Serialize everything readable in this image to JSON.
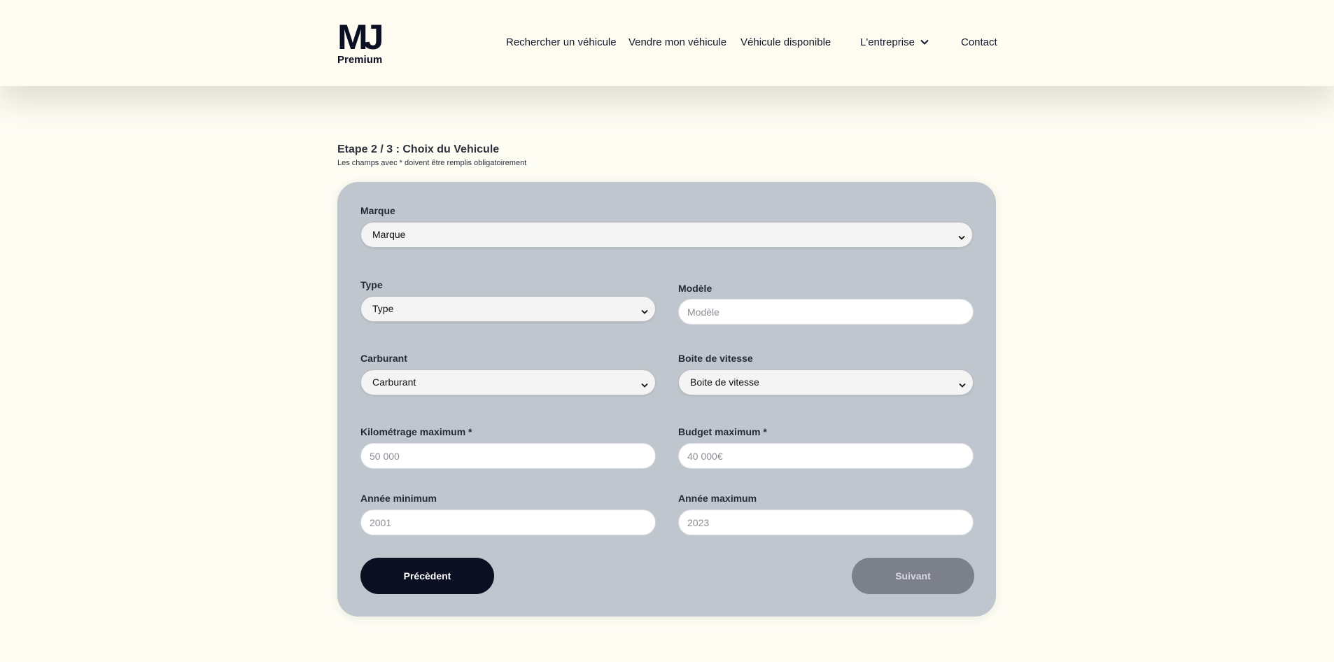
{
  "brand": {
    "logo_mark": "MJ",
    "logo_sub": "Premium"
  },
  "nav": {
    "items": [
      {
        "label": "Rechercher un véhicule"
      },
      {
        "label": "Vendre mon véhicule"
      },
      {
        "label": "Véhicule disponible"
      },
      {
        "label": "L'entreprise",
        "icon": "chevron-down-icon"
      },
      {
        "label": "Contact"
      }
    ]
  },
  "form": {
    "step_title": "Etape 2 / 3 : Choix du Vehicule",
    "required_note": "Les champs avec * doivent être remplis obligatoirement",
    "marque": {
      "label": "Marque",
      "selected": "Marque"
    },
    "type": {
      "label": "Type",
      "selected": "Type"
    },
    "modele": {
      "label": "Modèle",
      "placeholder": "Modèle",
      "value": ""
    },
    "carburant": {
      "label": "Carburant",
      "selected": "Carburant"
    },
    "boite": {
      "label": "Boite de vitesse",
      "selected": "Boite de vitesse"
    },
    "km_max": {
      "label": "Kilométrage maximum *",
      "placeholder": "50 000",
      "value": ""
    },
    "budget_max": {
      "label": "Budget maximum *",
      "placeholder": "40 000€",
      "value": ""
    },
    "annee_min": {
      "label": "Année minimum",
      "placeholder": "2001",
      "value": ""
    },
    "annee_max": {
      "label": "Année maximum",
      "placeholder": "2023",
      "value": ""
    },
    "prev_label": "Précèdent",
    "next_label": "Suivant"
  },
  "colors": {
    "page_bg": "#fefdf4",
    "card_bg": "#c0c6cd",
    "brand_dark": "#0b0f22",
    "next_disabled": "#7b808b"
  }
}
